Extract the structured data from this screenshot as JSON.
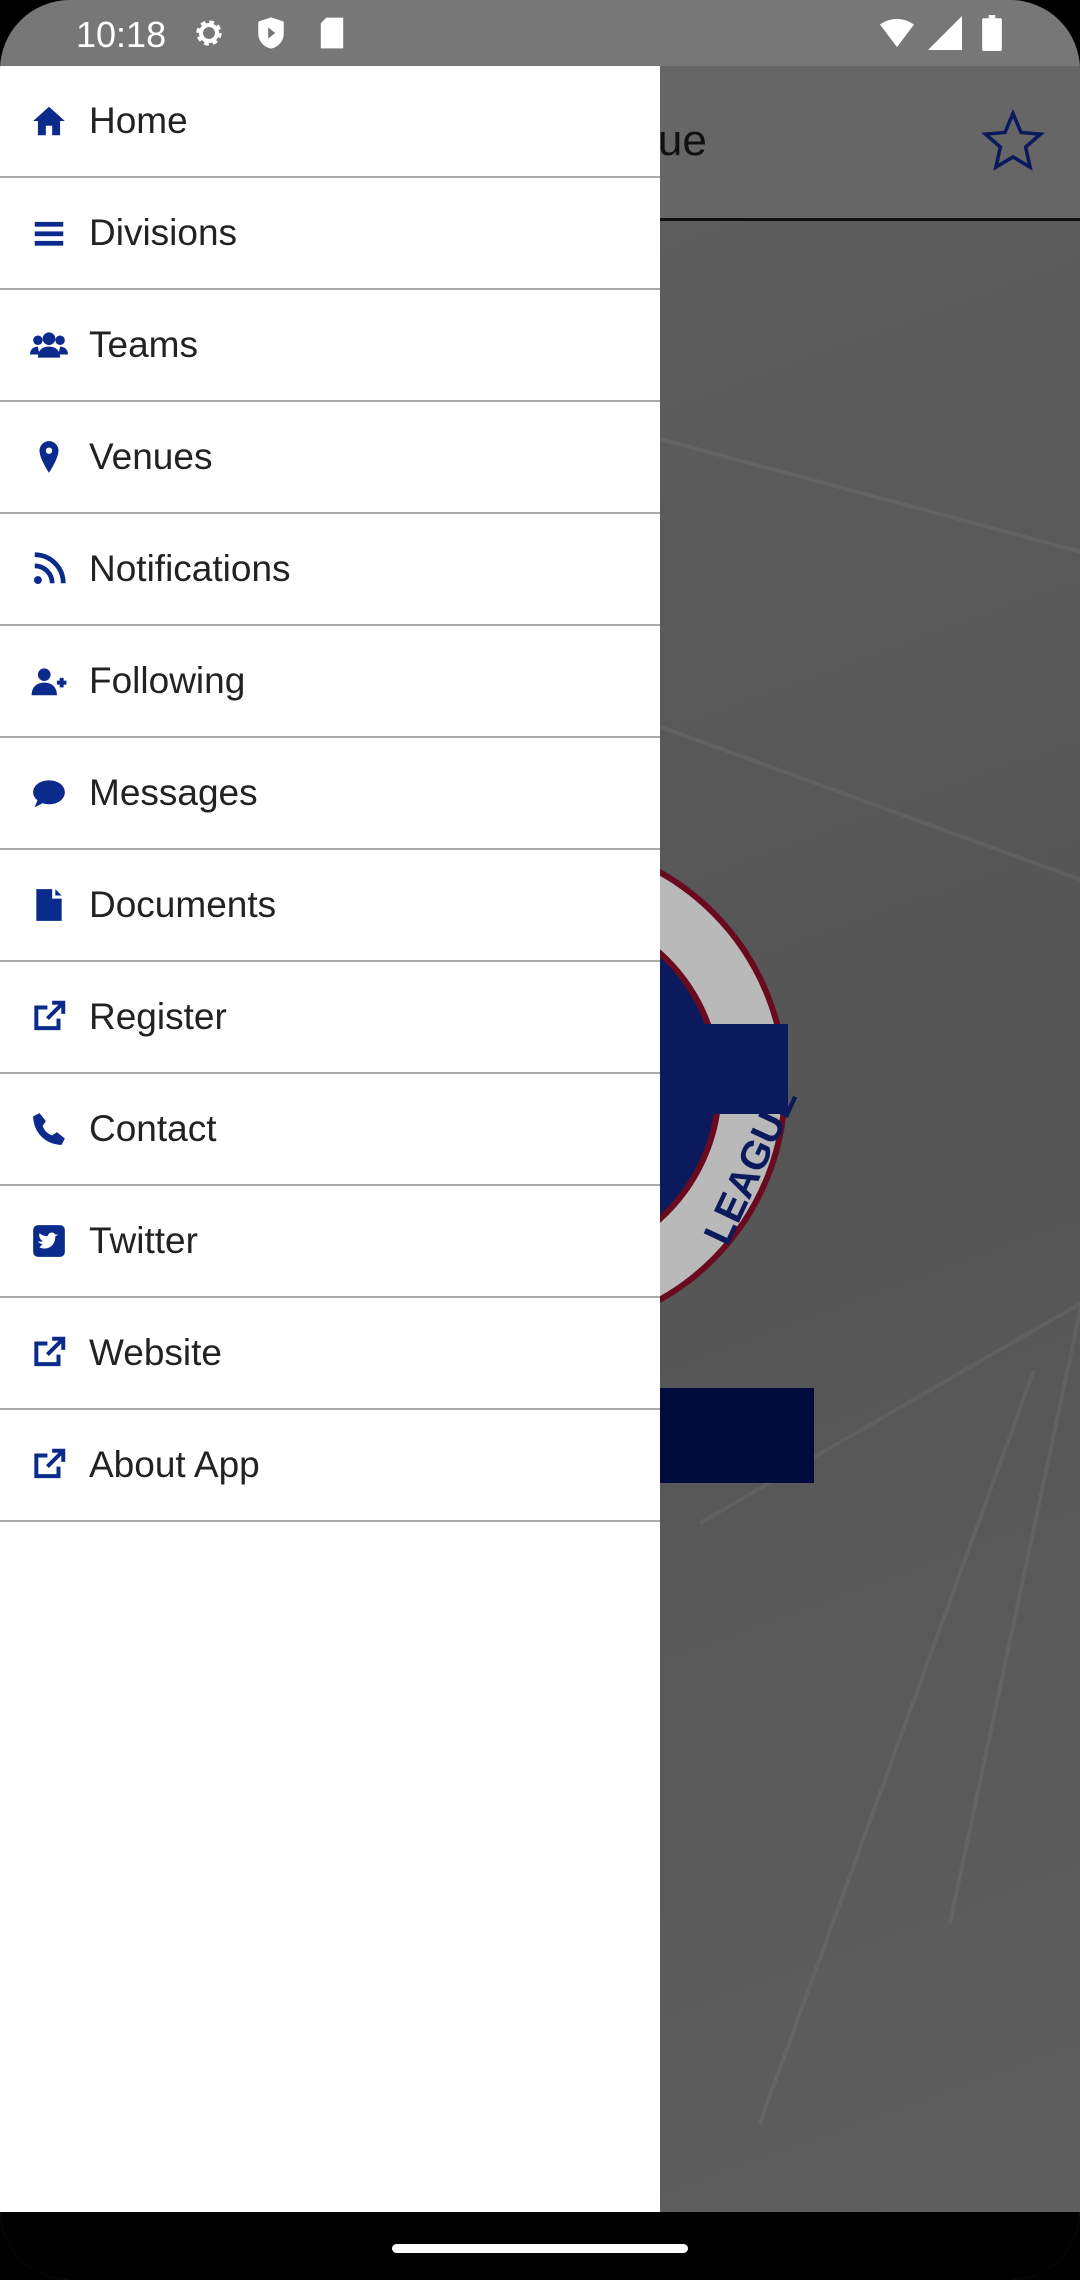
{
  "status_bar": {
    "time": "10:18",
    "icons": [
      "gear-icon",
      "shield-play-icon",
      "sd-card-icon",
      "wifi-icon",
      "signal-icon",
      "battery-icon"
    ]
  },
  "app_bar": {
    "title": "League",
    "favorite_icon": "star-outline-icon"
  },
  "colors": {
    "accent": "#0a2a8c",
    "drawer_bg": "#ffffff",
    "scrim": "#5a5a5a",
    "button": "#000c3c"
  },
  "drawer": {
    "items": [
      {
        "label": "Home",
        "icon": "home-icon"
      },
      {
        "label": "Divisions",
        "icon": "bars-icon"
      },
      {
        "label": "Teams",
        "icon": "users-icon"
      },
      {
        "label": "Venues",
        "icon": "map-pin-icon"
      },
      {
        "label": "Notifications",
        "icon": "rss-icon"
      },
      {
        "label": "Following",
        "icon": "user-plus-icon"
      },
      {
        "label": "Messages",
        "icon": "comment-icon"
      },
      {
        "label": "Documents",
        "icon": "file-icon"
      },
      {
        "label": "Register",
        "icon": "external-link-icon"
      },
      {
        "label": "Contact",
        "icon": "phone-icon"
      },
      {
        "label": "Twitter",
        "icon": "twitter-icon"
      },
      {
        "label": "Website",
        "icon": "external-link-icon"
      },
      {
        "label": "About App",
        "icon": "external-link-icon"
      }
    ]
  },
  "logo": {
    "text": "LEAGUE"
  }
}
